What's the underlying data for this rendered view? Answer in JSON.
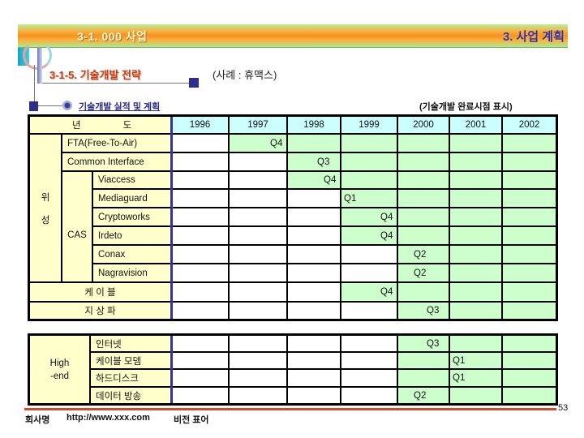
{
  "header": {
    "left_title": "3-1. 000 사업",
    "right_title": "3. 사업 계획"
  },
  "section": {
    "title": "3-1-5. 기술개발 전략",
    "example": "(사례 : 휴맥스)"
  },
  "subsection": {
    "link": "기술개발 실적 및 계획",
    "legend": "(기술개발 완료시점 표시)"
  },
  "colors": {
    "fill_done": "#ccffcc",
    "header_years": "#ccffff",
    "header_labels": "#ffffcc",
    "divider": "#333399",
    "footer_line": "#d24a2a"
  },
  "table1": {
    "header_label": [
      "년",
      "도"
    ],
    "years": [
      "1996",
      "1997",
      "1998",
      "1999",
      "2000",
      "2001",
      "2002"
    ],
    "group_satellite": [
      "위",
      "성"
    ],
    "group_cas": "CAS",
    "rows": [
      {
        "name": "FTA(Free-To-Air)",
        "group": "satellite",
        "fill_from": "1997",
        "label": "Q4",
        "label_year": "1997"
      },
      {
        "name": "Common Interface",
        "group": "satellite",
        "fill_from": "1998",
        "label": "Q3",
        "label_year": "1998"
      },
      {
        "name": "Viaccess",
        "group": "cas",
        "fill_from": "1998",
        "label": "Q4",
        "label_year": "1998"
      },
      {
        "name": "Mediaguard",
        "group": "cas",
        "fill_from": "1999",
        "label": "Q1",
        "label_year": "1999"
      },
      {
        "name": "Cryptoworks",
        "group": "cas",
        "fill_from": "1999",
        "label": "Q4",
        "label_year": "1999"
      },
      {
        "name": "Irdeto",
        "group": "cas",
        "fill_from": "1999",
        "label": "Q4",
        "label_year": "1999"
      },
      {
        "name": "Conax",
        "group": "cas",
        "fill_from": "2000",
        "label": "Q2",
        "label_year": "2000"
      },
      {
        "name": "Nagravision",
        "group": "cas",
        "fill_from": "2000",
        "label": "Q2",
        "label_year": "2000"
      },
      {
        "name": "케 이 블",
        "group": "standalone",
        "fill_from": "1999",
        "label": "Q4",
        "label_year": "1999"
      },
      {
        "name": "지 상 파",
        "group": "standalone",
        "fill_from": "2000",
        "label": "Q3",
        "label_year": "2000"
      }
    ]
  },
  "table2": {
    "group": [
      "High",
      "-end"
    ],
    "rows": [
      {
        "name": "인터넷",
        "fill_from": "2000",
        "label": "Q3",
        "label_year": "2000"
      },
      {
        "name": "케이블 모뎀",
        "fill_from": "2000",
        "label": "Q1",
        "label_year": "2001"
      },
      {
        "name": "하드디스크",
        "fill_from": "2000",
        "label": "Q1",
        "label_year": "2001"
      },
      {
        "name": "데이터 방송",
        "fill_from": "2000",
        "label": "Q2",
        "label_year": "2000"
      }
    ]
  },
  "footer": {
    "company": "회사명",
    "url": "http://www.xxx.com",
    "slogan": "비전 표어",
    "page": "53"
  }
}
